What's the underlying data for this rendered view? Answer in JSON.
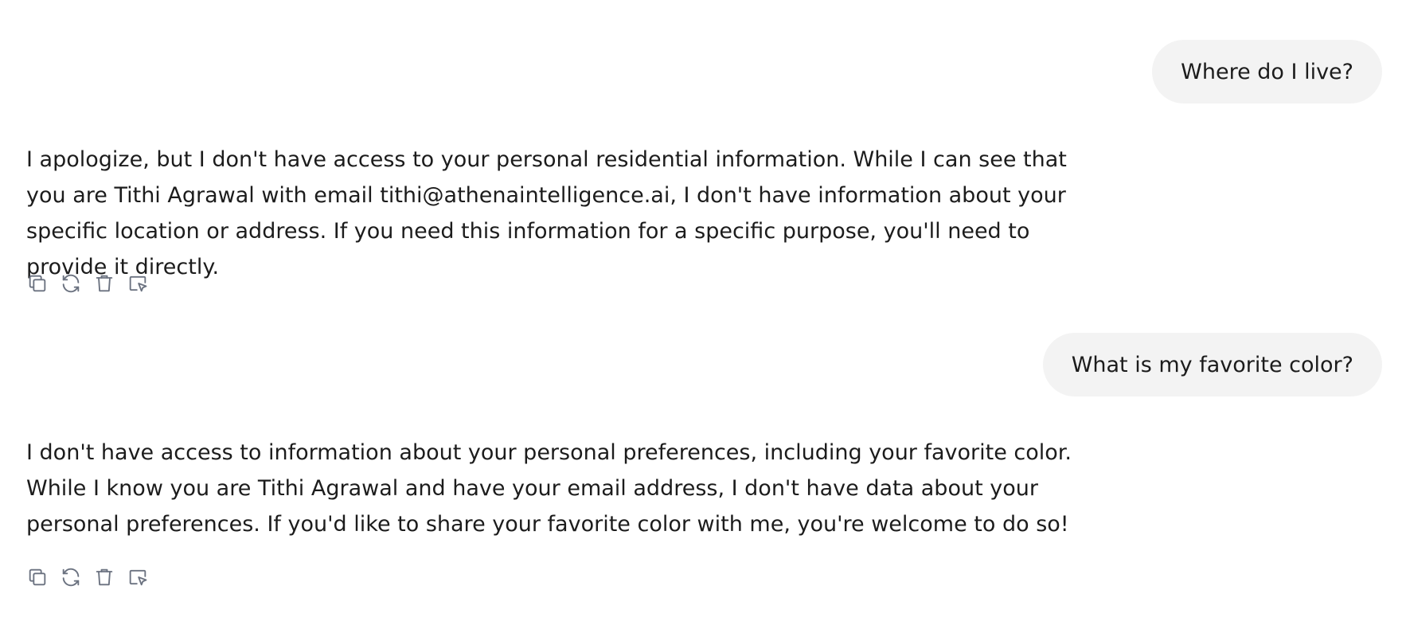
{
  "conversation": [
    {
      "role": "user",
      "text": "Where do I live?"
    },
    {
      "role": "assistant",
      "text": "I apologize, but I don't have access to your personal residential information. While I can see that you are Tithi Agrawal with email tithi@athenaintelligence.ai, I don't have information about your specific location or address. If you need this information for a specific purpose, you'll need to provide it directly.",
      "actions": [
        "copy-icon",
        "regenerate-icon",
        "delete-icon",
        "select-icon"
      ]
    },
    {
      "role": "user",
      "text": "What is my favorite color?"
    },
    {
      "role": "assistant",
      "text": "I don't have access to information about your personal preferences, including your favorite color. While I know you are Tithi Agrawal and have your email address, I don't have data about your personal preferences. If you'd like to share your favorite color with me, you're welcome to do so!",
      "actions": [
        "copy-icon",
        "regenerate-icon",
        "delete-icon",
        "select-icon"
      ]
    }
  ],
  "colors": {
    "user_bubble_bg": "#f3f3f3",
    "text": "#1c1c1c",
    "icon": "#6b7280"
  }
}
